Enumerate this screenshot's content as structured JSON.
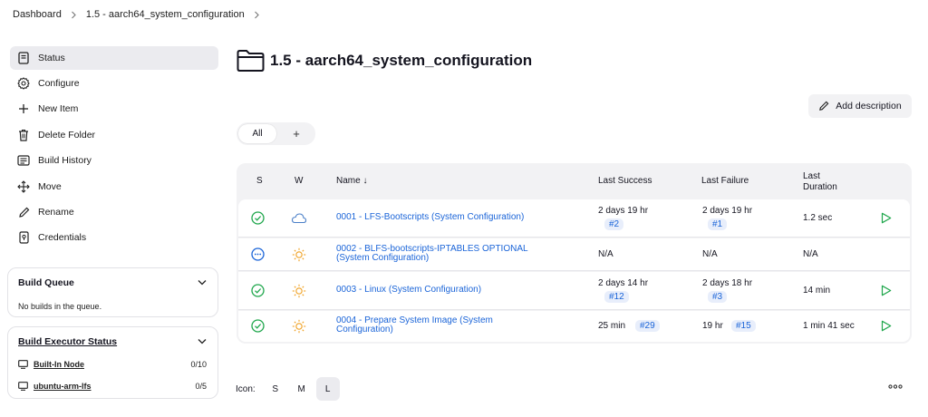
{
  "breadcrumb": {
    "items": [
      "Dashboard",
      "1.5 - aarch64_system_configuration"
    ]
  },
  "sidebar": {
    "tasks": [
      {
        "label": "Status",
        "icon": "status-icon"
      },
      {
        "label": "Configure",
        "icon": "gear-icon"
      },
      {
        "label": "New Item",
        "icon": "plus-icon"
      },
      {
        "label": "Delete Folder",
        "icon": "trash-icon"
      },
      {
        "label": "Build History",
        "icon": "history-icon"
      },
      {
        "label": "Move",
        "icon": "move-icon"
      },
      {
        "label": "Rename",
        "icon": "pencil-icon"
      },
      {
        "label": "Credentials",
        "icon": "credentials-icon"
      }
    ],
    "build_queue": {
      "title": "Build Queue",
      "empty_text": "No builds in the queue."
    },
    "executors": {
      "title": "Build Executor Status",
      "nodes": [
        {
          "name": "Built-In Node",
          "count": "0/10"
        },
        {
          "name": "ubuntu-arm-lfs",
          "count": "0/5"
        }
      ]
    }
  },
  "main": {
    "title": "1.5 - aarch64_system_configuration",
    "add_description": "Add description",
    "tabs": {
      "all": "All",
      "add": "+"
    },
    "table": {
      "headers": {
        "s": "S",
        "w": "W",
        "name": "Name ↓",
        "last_success": "Last Success",
        "last_failure": "Last Failure",
        "last_duration_1": "Last",
        "last_duration_2": "Duration"
      },
      "rows": [
        {
          "status": "success",
          "weather": "cloudy",
          "name_1": "0001 - LFS-Bootscripts (System Configuration)",
          "name_2": "",
          "success_text": "2 days 19 hr",
          "success_build": "#2",
          "failure_text": "2 days 19 hr",
          "failure_build": "#1",
          "duration": "1.2 sec"
        },
        {
          "status": "not-built",
          "weather": "sunny",
          "name_1": "0002 - BLFS-bootscripts-IPTABLES OPTIONAL",
          "name_2": "(System Configuration)",
          "success_text": "N/A",
          "success_build": "",
          "failure_text": "N/A",
          "failure_build": "",
          "duration": "N/A"
        },
        {
          "status": "success",
          "weather": "sunny",
          "name_1": "0003 - Linux (System Configuration)",
          "name_2": "",
          "success_text": "2 days 14 hr",
          "success_build": "#12",
          "failure_text": "2 days 18 hr",
          "failure_build": "#3",
          "duration": "14 min"
        },
        {
          "status": "success",
          "weather": "sunny",
          "name_1": "0004 - Prepare System Image (System",
          "name_2": "Configuration)",
          "success_text": "25 min",
          "success_build": "#29",
          "failure_text": "19 hr",
          "failure_build": "#15",
          "duration": "1 min 41 sec"
        }
      ]
    },
    "icon_size": {
      "label": "Icon:",
      "options": [
        "S",
        "M",
        "L"
      ],
      "selected": "L"
    }
  },
  "colors": {
    "success": "#1ea64b",
    "running": "#1a64d8",
    "sunny": "#f0a020",
    "cloudy": "#4a7fc8",
    "link": "#1a64d8",
    "play": "#1ea64b"
  }
}
